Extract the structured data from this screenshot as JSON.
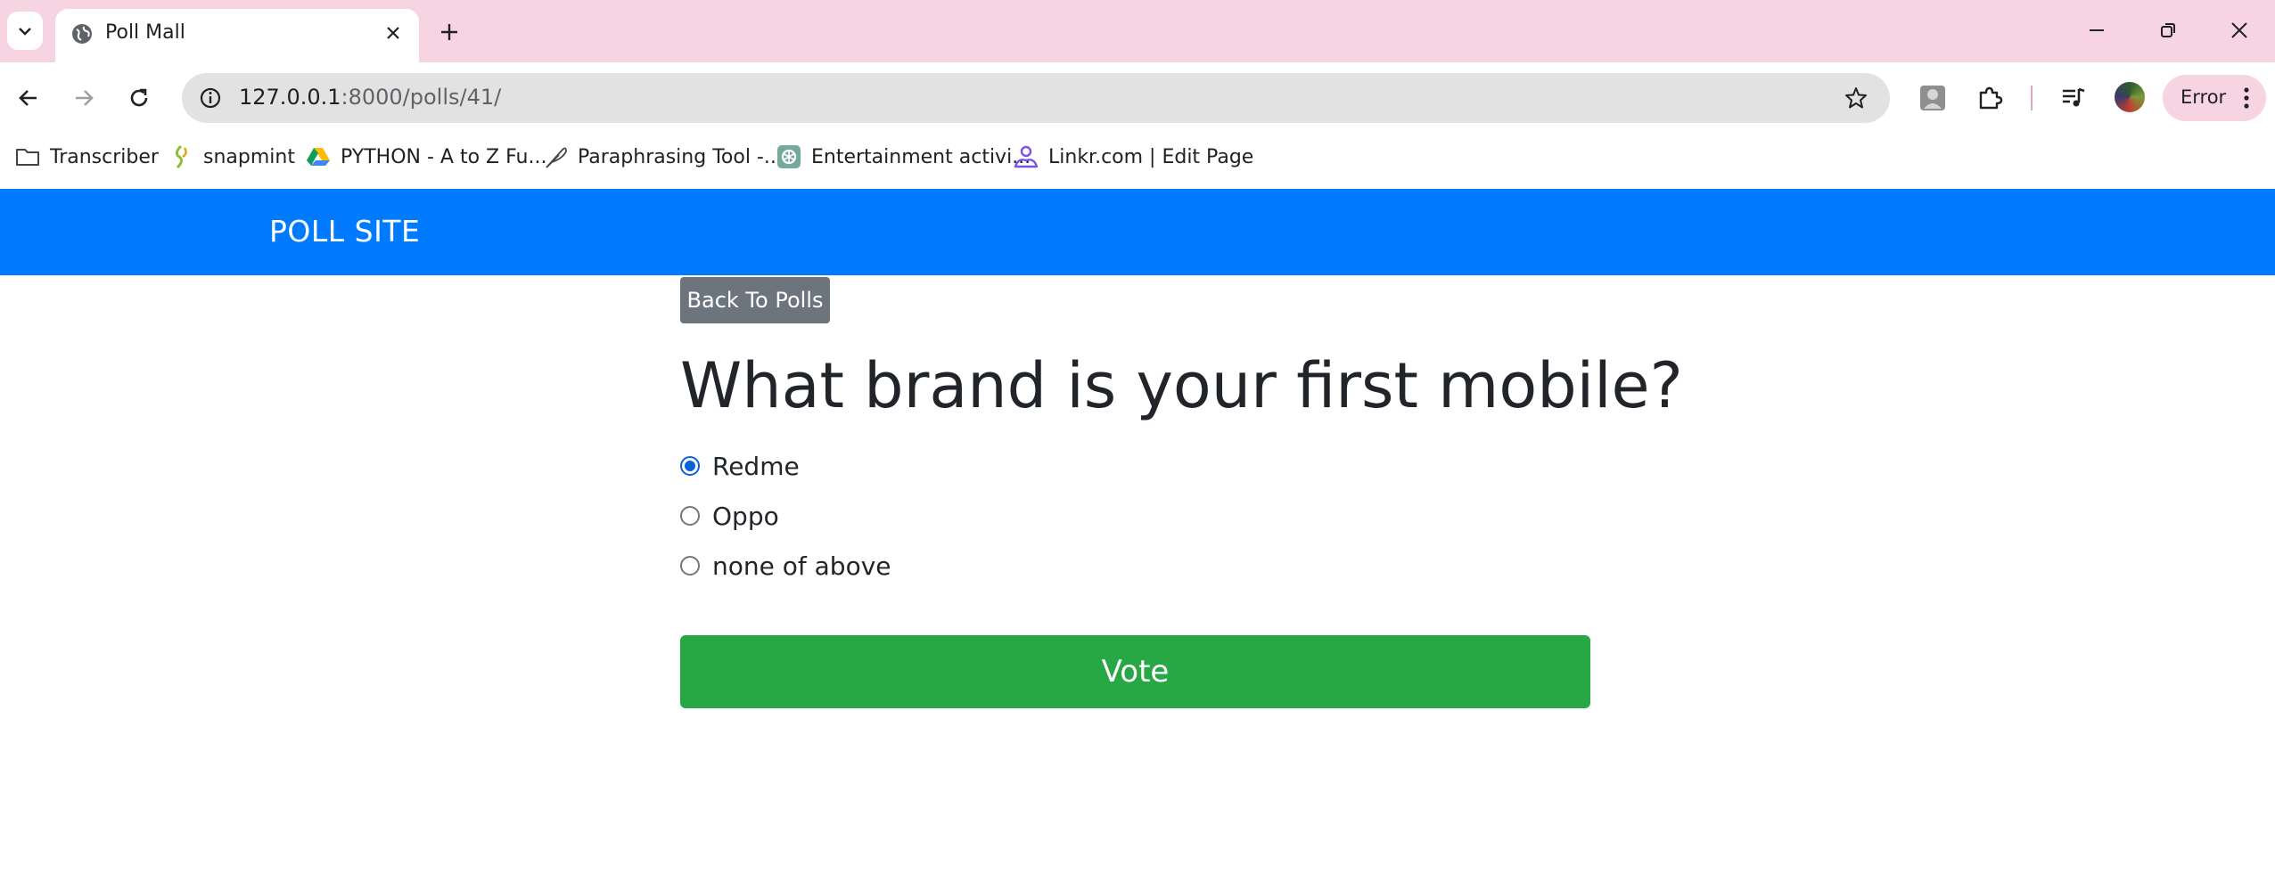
{
  "browser": {
    "tab": {
      "title": "Poll Mall"
    },
    "address": {
      "host": "127.0.0.1",
      "path": ":8000/polls/41/"
    },
    "profile_chip": "Error",
    "bookmarks": [
      {
        "label": "Transcriber",
        "icon": "folder-icon"
      },
      {
        "label": "snapmint",
        "icon": "snapmint-icon"
      },
      {
        "label": "PYTHON - A to Z Fu...",
        "icon": "google-drive-icon"
      },
      {
        "label": "Paraphrasing Tool -...",
        "icon": "feather-icon"
      },
      {
        "label": "Entertainment activi...",
        "icon": "chatgpt-icon"
      },
      {
        "label": "Linkr.com | Edit Page",
        "icon": "linkr-icon"
      }
    ]
  },
  "site": {
    "brand": "POLL SITE",
    "back_button": "Back To Polls",
    "question": "What brand is your first mobile?",
    "choices": [
      {
        "label": "Redme",
        "selected": true
      },
      {
        "label": "Oppo",
        "selected": false
      },
      {
        "label": "none of above",
        "selected": false
      }
    ],
    "vote_button": "Vote"
  },
  "colors": {
    "navbar": "#007bff",
    "back_button": "#6c757d",
    "vote_button": "#28a745",
    "tabstrip": "#f7d4e2"
  }
}
